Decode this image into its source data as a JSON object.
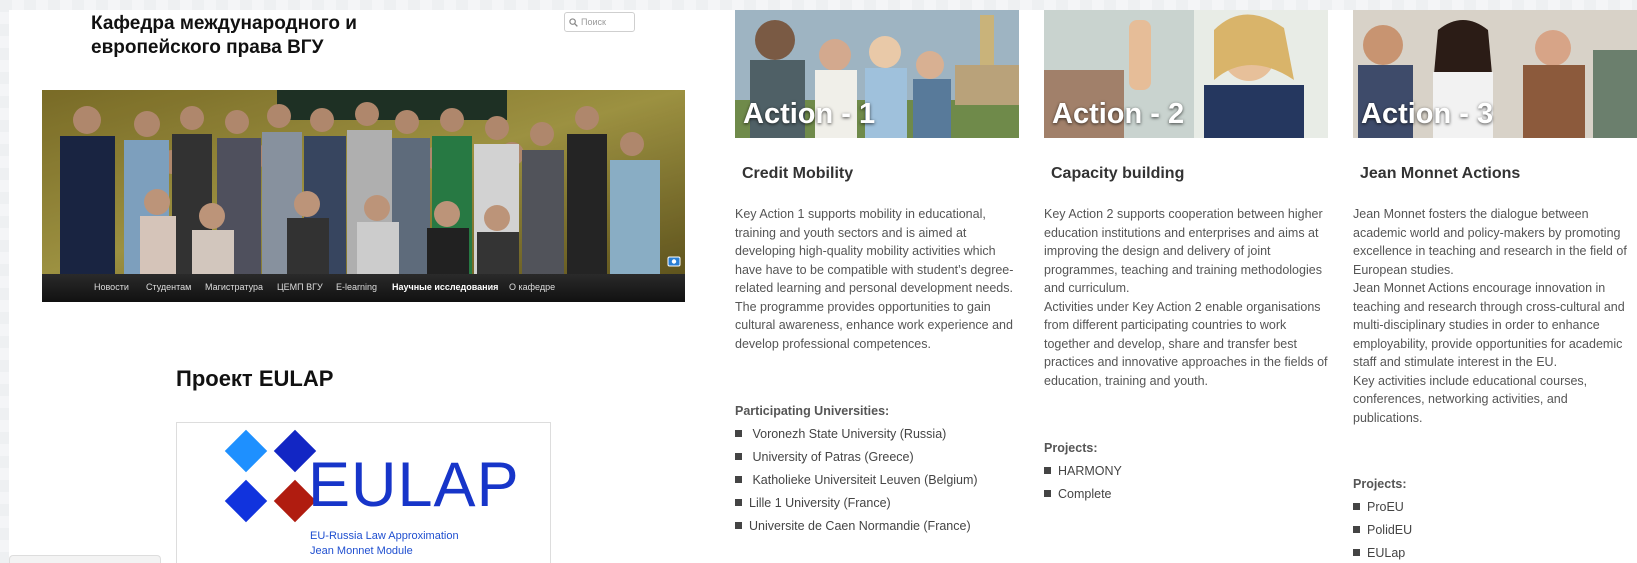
{
  "site": {
    "title": "Кафедра международного и европейского права ВГУ",
    "search_placeholder": "Поиск"
  },
  "nav": {
    "items": [
      {
        "label": "Новости"
      },
      {
        "label": "Студентам"
      },
      {
        "label": "Магистратура"
      },
      {
        "label": "ЦЕМП ВГУ"
      },
      {
        "label": "E-learning"
      },
      {
        "label": "Научные исследования",
        "active": true
      },
      {
        "label": "О кафедре"
      }
    ]
  },
  "project": {
    "title": "Проект EULAP",
    "logo_text": "EULAP",
    "logo_sub1": "EU-Russia Law Approximation",
    "logo_sub2": "Jean Monnet Module"
  },
  "columns": [
    {
      "image_label": "Action - 1",
      "title": "Credit Mobility",
      "desc": [
        "Key Action 1 supports mobility in educational, training and youth sectors and is aimed at developing high-quality mobility activities which have have to be compatible with student’s degree-related learning and personal development needs. The programme provides opportunities to gain cultural awareness, enhance work experience and develop professional competences."
      ],
      "list_heading": "Participating Universities:",
      "items": [
        " Voronezh State University (Russia)",
        " University of Patras (Greece)",
        " Katholieke Universiteit Leuven (Belgium)",
        "Lille 1 University (France)",
        "Universite de Caen Normandie (France)"
      ]
    },
    {
      "image_label": "Action - 2",
      "title": "Capacity building",
      "desc": [
        "Key Action 2 supports cooperation between higher education institutions and enterprises and aims at improving the design and delivery of joint programmes, teaching and training methodologies and curriculum.",
        "Activities under Key Action 2 enable organisations from different participating countries to work together and develop, share and transfer best practices and innovative approaches in the fields of education, training and youth."
      ],
      "list_heading": "Projects:",
      "items": [
        "HARMONY",
        "Complete"
      ]
    },
    {
      "image_label": "Action - 3",
      "title": "Jean Monnet Actions",
      "desc": [
        "Jean Monnet fosters the dialogue between academic world and policy-makers by promoting excellence in teaching and research in the field of European studies.",
        "Jean Monnet Actions encourage innovation in teaching and research through cross-cultural and multi-disciplinary studies in order to enhance employability, provide opportunities for academic staff and stimulate interest in the EU.",
        "Key activities include educational courses, conferences, networking activities, and publications."
      ],
      "list_heading": "Projects:",
      "items": [
        "ProEU",
        "PolidEU",
        "EULap"
      ]
    }
  ],
  "icons": {
    "search": "search-icon",
    "camera": "camera-icon",
    "bullet": "square-bullet-icon"
  },
  "colors": {
    "nav_bg": "#1a1a1a",
    "logo_blue": "#1735c9",
    "logo_light_blue": "#1e90ff",
    "logo_red": "#b01c10"
  }
}
